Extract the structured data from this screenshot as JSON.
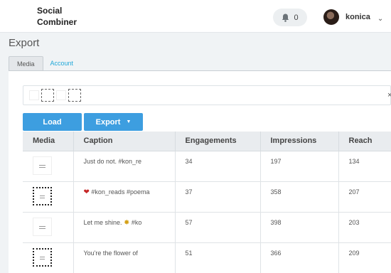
{
  "header": {
    "logo_line1": "Social",
    "logo_line2": "Combiner",
    "notification_count": "0",
    "username": "konica"
  },
  "page": {
    "title": "Export",
    "tabs": [
      {
        "label": "Media",
        "active": true
      },
      {
        "label": "Account",
        "active": false
      }
    ]
  },
  "selector": {
    "clear_label": "×",
    "dropdown_label": "▼"
  },
  "buttons": {
    "load_label": "Load",
    "export_label": "Export"
  },
  "table": {
    "columns": [
      "Media",
      "Caption",
      "Engagements",
      "Impressions",
      "Reach"
    ],
    "rows": [
      {
        "thumb": "plain",
        "caption": "Just do not. #kon_re",
        "engagements": "34",
        "impressions": "197",
        "reach": "134"
      },
      {
        "thumb": "framed",
        "caption": "#kon_reads #poema",
        "caption_icon": "heart-icon",
        "engagements": "37",
        "impressions": "358",
        "reach": "207"
      },
      {
        "thumb": "plain",
        "caption": "Let me shine. ",
        "caption_icon_after": "sun-icon",
        "caption_tail": " #ko",
        "engagements": "57",
        "impressions": "398",
        "reach": "203"
      },
      {
        "thumb": "framed",
        "caption": "You're the flower of",
        "engagements": "51",
        "impressions": "366",
        "reach": "209"
      }
    ]
  },
  "colors": {
    "primary": "#3d9ee0",
    "link": "#20a8d8"
  }
}
